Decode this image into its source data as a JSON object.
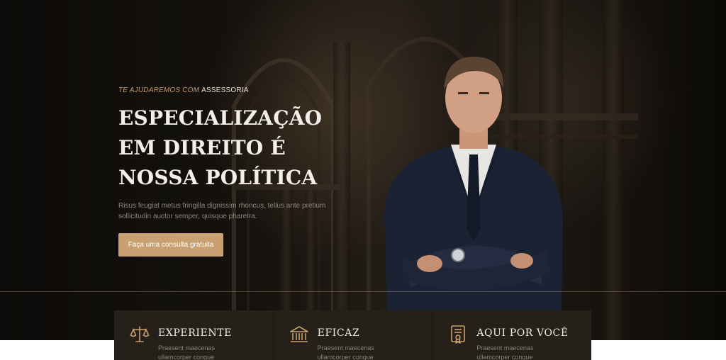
{
  "hero": {
    "eyebrow_prefix": "TE AJUDAREMOS COM",
    "eyebrow_accent": "ASSESSORIA",
    "headline": "ESPECIALIZAÇÃO EM DIREITO É NOSSA POLÍTICA",
    "lead": "Risus feugiat metus fringilla dignissim rhoncus, tellus ante pretium sollicitudin auctor semper, quisque pharetra.",
    "cta_label": "Faça uma consulta gratuita"
  },
  "features": [
    {
      "icon": "scales-icon",
      "title": "EXPERIENTE",
      "text": "Praesent maecenas ullamcorper congue"
    },
    {
      "icon": "courthouse-icon",
      "title": "EFICAZ",
      "text": "Praesent maecenas ullamcorper congue"
    },
    {
      "icon": "certificate-icon",
      "title": "AQUI POR VOCÊ",
      "text": "Praesent maecenas ullamcorper congue"
    }
  ],
  "colors": {
    "accent": "#c9a071",
    "hero_dark": "#15120e",
    "card_bg": "#26201a",
    "headline_text": "#f3eee7"
  }
}
